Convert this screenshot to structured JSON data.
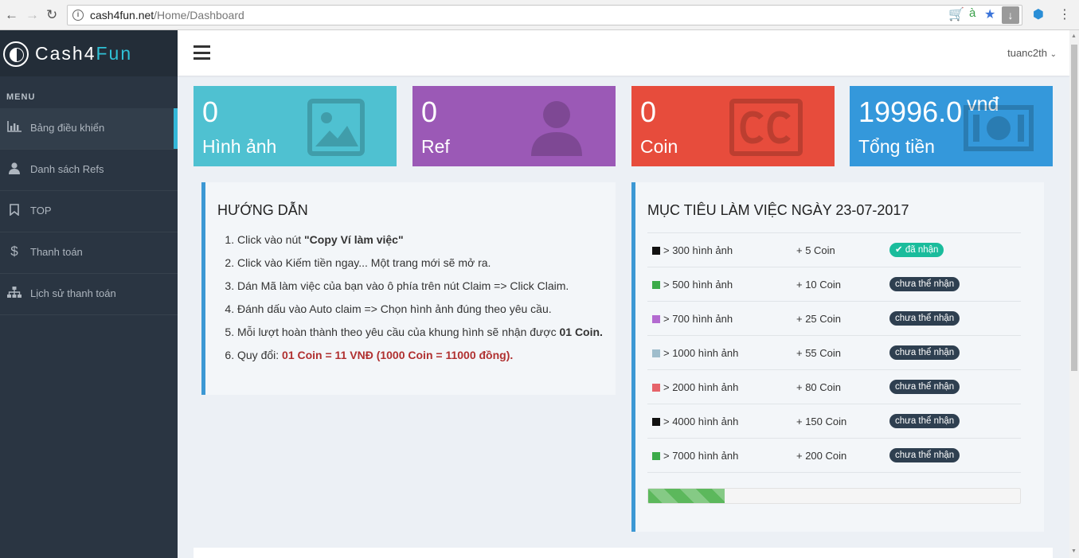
{
  "browser": {
    "url_host": "cash4fun.net",
    "url_path": "/Home/Dashboard"
  },
  "brand": {
    "part1": "Cash4",
    "part2": "Fun"
  },
  "sidebar": {
    "menu_header": "MENU",
    "items": [
      {
        "label": "Bảng điều khiển",
        "icon": "bar-chart-icon",
        "active": true
      },
      {
        "label": "Danh sách Refs",
        "icon": "user-icon"
      },
      {
        "label": "TOP",
        "icon": "bookmark-icon"
      },
      {
        "label": "Thanh toán",
        "icon": "dollar-icon"
      },
      {
        "label": "Lịch sử thanh toán",
        "icon": "sitemap-icon"
      }
    ]
  },
  "header": {
    "username": "tuanc2th"
  },
  "stats": [
    {
      "value": "0",
      "label": "Hình ảnh",
      "color": "#4fc1d1",
      "icon": "image-icon"
    },
    {
      "value": "0",
      "label": "Ref",
      "color": "#9b59b6",
      "icon": "user-icon"
    },
    {
      "value": "0",
      "label": "Coin",
      "color": "#e74c3c",
      "icon": "cc-icon"
    },
    {
      "value": "19996.0",
      "unit": "vnđ",
      "label": "Tổng tiền",
      "color": "#3498db",
      "icon": "money-icon"
    }
  ],
  "guide": {
    "title": "HƯỚNG DẪN",
    "steps": [
      {
        "pre": "Click vào nút ",
        "bold": "\"Copy Ví làm việc\"",
        "post": ""
      },
      {
        "pre": "Click vào Kiếm tiền ngay... Một trang mới sẽ mở ra.",
        "bold": "",
        "post": ""
      },
      {
        "pre": "Dán Mã làm việc của bạn vào ô phía trên nút Claim => Click Claim.",
        "bold": "",
        "post": ""
      },
      {
        "pre": "Đánh dấu vào Auto claim => Chọn hình ảnh đúng theo yêu cầu.",
        "bold": "",
        "post": ""
      },
      {
        "pre": "Mỗi lượt hoàn thành theo yêu cầu của khung hình sẽ nhận được ",
        "bold": "01 Coin.",
        "post": ""
      },
      {
        "pre": "Quy đổi: ",
        "red": "01 Coin = 11 VNĐ (1000 Coin = 11000 đồng).",
        "post": ""
      }
    ]
  },
  "target": {
    "title": "MỤC TIÊU LÀM VIỆC NGÀY 23-07-2017",
    "rows": [
      {
        "goal": "> 300 hình ảnh",
        "reward": "+ 5 Coin",
        "status": "đã nhận",
        "done": true,
        "color": "#111111"
      },
      {
        "goal": "> 500 hình ảnh",
        "reward": "+ 10 Coin",
        "status": "chưa thể nhận",
        "done": false,
        "color": "#3cab4a"
      },
      {
        "goal": "> 700 hình ảnh",
        "reward": "+ 25 Coin",
        "status": "chưa thể nhận",
        "done": false,
        "color": "#b36ad0"
      },
      {
        "goal": "> 1000 hình ảnh",
        "reward": "+ 55 Coin",
        "status": "chưa thể nhận",
        "done": false,
        "color": "#9fbdcc"
      },
      {
        "goal": "> 2000 hình ảnh",
        "reward": "+ 80 Coin",
        "status": "chưa thể nhận",
        "done": false,
        "color": "#e6636a"
      },
      {
        "goal": "> 4000 hình ảnh",
        "reward": "+ 150 Coin",
        "status": "chưa thể nhận",
        "done": false,
        "color": "#111111"
      },
      {
        "goal": "> 7000 hình ảnh",
        "reward": "+ 200 Coin",
        "status": "chưa thể nhận",
        "done": false,
        "color": "#3cab4a"
      }
    ],
    "progress_percent": 20.5
  }
}
